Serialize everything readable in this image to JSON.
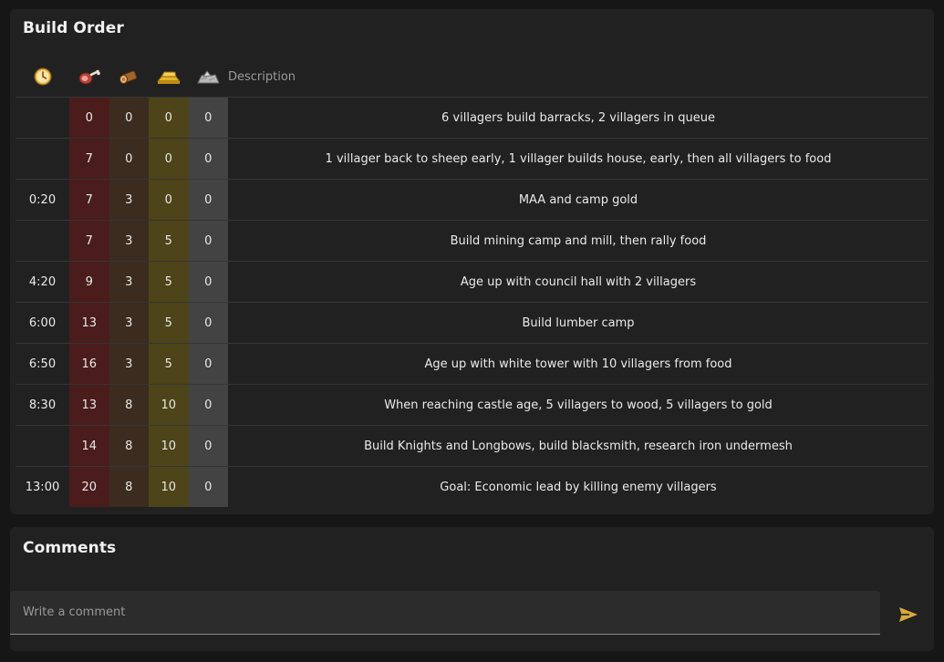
{
  "build_order": {
    "title": "Build Order",
    "columns": {
      "time_icon": "clock-icon",
      "food_icon": "meat-icon",
      "wood_icon": "log-icon",
      "gold_icon": "gold-bars-icon",
      "stone_icon": "stone-icon",
      "description": "Description"
    },
    "colors": {
      "food": "#4a1c1c",
      "wood": "#3b2c1f",
      "gold": "#4d4419",
      "stone": "#434343"
    },
    "steps": [
      {
        "time": "",
        "food": "0",
        "wood": "0",
        "gold": "0",
        "stone": "0",
        "description": "6 villagers build barracks, 2 villagers in queue"
      },
      {
        "time": "",
        "food": "7",
        "wood": "0",
        "gold": "0",
        "stone": "0",
        "description": "1 villager back to sheep early, 1 villager builds house, early, then all villagers to food"
      },
      {
        "time": "0:20",
        "food": "7",
        "wood": "3",
        "gold": "0",
        "stone": "0",
        "description": "MAA and camp gold"
      },
      {
        "time": "",
        "food": "7",
        "wood": "3",
        "gold": "5",
        "stone": "0",
        "description": "Build mining camp and mill, then rally food"
      },
      {
        "time": "4:20",
        "food": "9",
        "wood": "3",
        "gold": "5",
        "stone": "0",
        "description": "Age up with council hall with 2 villagers"
      },
      {
        "time": "6:00",
        "food": "13",
        "wood": "3",
        "gold": "5",
        "stone": "0",
        "description": "Build lumber camp"
      },
      {
        "time": "6:50",
        "food": "16",
        "wood": "3",
        "gold": "5",
        "stone": "0",
        "description": "Age up with white tower with 10 villagers from food"
      },
      {
        "time": "8:30",
        "food": "13",
        "wood": "8",
        "gold": "10",
        "stone": "0",
        "description": "When reaching castle age, 5 villagers to wood, 5 villagers to gold"
      },
      {
        "time": "",
        "food": "14",
        "wood": "8",
        "gold": "10",
        "stone": "0",
        "description": "Build Knights and Longbows, build blacksmith, research iron undermesh"
      },
      {
        "time": "13:00",
        "food": "20",
        "wood": "8",
        "gold": "10",
        "stone": "0",
        "description": "Goal: Economic lead by killing enemy villagers"
      }
    ]
  },
  "comments": {
    "title": "Comments",
    "input_value": "",
    "input_placeholder": "Write a comment",
    "send_icon": "send-icon",
    "accent": "#d9a93a"
  }
}
